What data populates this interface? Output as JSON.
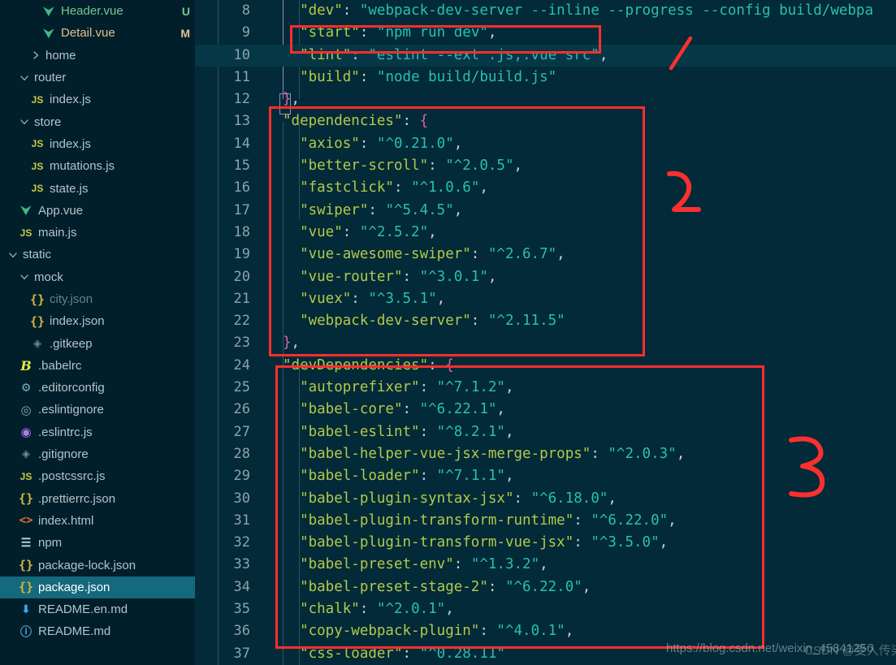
{
  "sidebar": {
    "items": [
      {
        "label": "Header.vue",
        "icon": "vue-icon",
        "indent": 3,
        "chevron": "none",
        "git": "U",
        "state": "untracked"
      },
      {
        "label": "Detail.vue",
        "icon": "vue-icon",
        "indent": 3,
        "chevron": "none",
        "git": "M",
        "state": "modified"
      },
      {
        "label": "home",
        "icon": "none",
        "indent": 2,
        "chevron": "right",
        "git": "",
        "state": "normal"
      },
      {
        "label": "router",
        "icon": "none",
        "indent": 1,
        "chevron": "down",
        "git": "",
        "state": "normal"
      },
      {
        "label": "index.js",
        "icon": "js-icon",
        "indent": 2,
        "chevron": "none",
        "git": "",
        "state": "normal"
      },
      {
        "label": "store",
        "icon": "none",
        "indent": 1,
        "chevron": "down",
        "git": "",
        "state": "normal"
      },
      {
        "label": "index.js",
        "icon": "js-icon",
        "indent": 2,
        "chevron": "none",
        "git": "",
        "state": "normal"
      },
      {
        "label": "mutations.js",
        "icon": "js-icon",
        "indent": 2,
        "chevron": "none",
        "git": "",
        "state": "normal"
      },
      {
        "label": "state.js",
        "icon": "js-icon",
        "indent": 2,
        "chevron": "none",
        "git": "",
        "state": "normal"
      },
      {
        "label": "App.vue",
        "icon": "vue-icon",
        "indent": 1,
        "chevron": "none",
        "git": "",
        "state": "normal"
      },
      {
        "label": "main.js",
        "icon": "js-icon",
        "indent": 1,
        "chevron": "none",
        "git": "",
        "state": "normal"
      },
      {
        "label": "static",
        "icon": "none",
        "indent": 0,
        "chevron": "down",
        "git": "",
        "state": "normal"
      },
      {
        "label": "mock",
        "icon": "none",
        "indent": 1,
        "chevron": "down",
        "git": "",
        "state": "normal"
      },
      {
        "label": "city.json",
        "icon": "json-icon",
        "indent": 2,
        "chevron": "none",
        "git": "",
        "state": "dim"
      },
      {
        "label": "index.json",
        "icon": "json-icon",
        "indent": 2,
        "chevron": "none",
        "git": "",
        "state": "normal"
      },
      {
        "label": ".gitkeep",
        "icon": "diamond-icon",
        "indent": 2,
        "chevron": "none",
        "git": "",
        "state": "normal"
      },
      {
        "label": ".babelrc",
        "icon": "babel-icon",
        "indent": 1,
        "chevron": "none",
        "git": "",
        "state": "normal"
      },
      {
        "label": ".editorconfig",
        "icon": "gear-icon",
        "indent": 1,
        "chevron": "none",
        "git": "",
        "state": "normal"
      },
      {
        "label": ".eslintignore",
        "icon": "eslint-ignore-icon",
        "indent": 1,
        "chevron": "none",
        "git": "",
        "state": "normal"
      },
      {
        "label": ".eslintrc.js",
        "icon": "eslint-icon",
        "indent": 1,
        "chevron": "none",
        "git": "",
        "state": "normal"
      },
      {
        "label": ".gitignore",
        "icon": "diamond-icon",
        "indent": 1,
        "chevron": "none",
        "git": "",
        "state": "normal"
      },
      {
        "label": ".postcssrc.js",
        "icon": "js-icon",
        "indent": 1,
        "chevron": "none",
        "git": "",
        "state": "normal"
      },
      {
        "label": ".prettierrc.json",
        "icon": "json-icon",
        "indent": 1,
        "chevron": "none",
        "git": "",
        "state": "normal"
      },
      {
        "label": "index.html",
        "icon": "html-icon",
        "indent": 1,
        "chevron": "none",
        "git": "",
        "state": "normal"
      },
      {
        "label": "npm",
        "icon": "list-icon",
        "indent": 1,
        "chevron": "none",
        "git": "",
        "state": "normal"
      },
      {
        "label": "package-lock.json",
        "icon": "json-icon",
        "indent": 1,
        "chevron": "none",
        "git": "",
        "state": "normal"
      },
      {
        "label": "package.json",
        "icon": "json-icon",
        "indent": 1,
        "chevron": "none",
        "git": "",
        "state": "selected"
      },
      {
        "label": "README.en.md",
        "icon": "download-icon",
        "indent": 1,
        "chevron": "none",
        "git": "",
        "state": "normal"
      },
      {
        "label": "README.md",
        "icon": "info-icon",
        "indent": 1,
        "chevron": "none",
        "git": "",
        "state": "normal"
      }
    ]
  },
  "editor": {
    "first_line_number": 8,
    "active_line_number": 10,
    "lines": [
      {
        "n": 8,
        "tokens": [
          {
            "t": "\"dev\"",
            "c": "k"
          },
          {
            "t": ": ",
            "c": "p"
          },
          {
            "t": "\"webpack-dev-server --inline --progress --config build/webpa",
            "c": "v"
          }
        ],
        "indent": 2
      },
      {
        "n": 9,
        "tokens": [
          {
            "t": "\"start\"",
            "c": "k"
          },
          {
            "t": ": ",
            "c": "p"
          },
          {
            "t": "\"npm run dev\"",
            "c": "v"
          },
          {
            "t": ",",
            "c": "p"
          }
        ],
        "indent": 2
      },
      {
        "n": 10,
        "tokens": [
          {
            "t": "\"lint\"",
            "c": "k"
          },
          {
            "t": ": ",
            "c": "p"
          },
          {
            "t": "\"eslint --ext .js,.vue src\"",
            "c": "v"
          },
          {
            "t": ",",
            "c": "p"
          }
        ],
        "indent": 2
      },
      {
        "n": 11,
        "tokens": [
          {
            "t": "\"build\"",
            "c": "k"
          },
          {
            "t": ": ",
            "c": "p"
          },
          {
            "t": "\"node build/build.js\"",
            "c": "v"
          }
        ],
        "indent": 2
      },
      {
        "n": 12,
        "tokens": [
          {
            "t": "}",
            "c": "br"
          },
          {
            "t": ",",
            "c": "p"
          }
        ],
        "indent": 1
      },
      {
        "n": 13,
        "tokens": [
          {
            "t": "\"dependencies\"",
            "c": "k"
          },
          {
            "t": ": ",
            "c": "p"
          },
          {
            "t": "{",
            "c": "br"
          }
        ],
        "indent": 1
      },
      {
        "n": 14,
        "tokens": [
          {
            "t": "\"axios\"",
            "c": "k"
          },
          {
            "t": ": ",
            "c": "p"
          },
          {
            "t": "\"^0.21.0\"",
            "c": "v"
          },
          {
            "t": ",",
            "c": "p"
          }
        ],
        "indent": 2
      },
      {
        "n": 15,
        "tokens": [
          {
            "t": "\"better-scroll\"",
            "c": "k"
          },
          {
            "t": ": ",
            "c": "p"
          },
          {
            "t": "\"^2.0.5\"",
            "c": "v"
          },
          {
            "t": ",",
            "c": "p"
          }
        ],
        "indent": 2
      },
      {
        "n": 16,
        "tokens": [
          {
            "t": "\"fastclick\"",
            "c": "k"
          },
          {
            "t": ": ",
            "c": "p"
          },
          {
            "t": "\"^1.0.6\"",
            "c": "v"
          },
          {
            "t": ",",
            "c": "p"
          }
        ],
        "indent": 2
      },
      {
        "n": 17,
        "tokens": [
          {
            "t": "\"swiper\"",
            "c": "k"
          },
          {
            "t": ": ",
            "c": "p"
          },
          {
            "t": "\"^5.4.5\"",
            "c": "v"
          },
          {
            "t": ",",
            "c": "p"
          }
        ],
        "indent": 2
      },
      {
        "n": 18,
        "tokens": [
          {
            "t": "\"vue\"",
            "c": "k"
          },
          {
            "t": ": ",
            "c": "p"
          },
          {
            "t": "\"^2.5.2\"",
            "c": "v"
          },
          {
            "t": ",",
            "c": "p"
          }
        ],
        "indent": 2
      },
      {
        "n": 19,
        "tokens": [
          {
            "t": "\"vue-awesome-swiper\"",
            "c": "k"
          },
          {
            "t": ": ",
            "c": "p"
          },
          {
            "t": "\"^2.6.7\"",
            "c": "v"
          },
          {
            "t": ",",
            "c": "p"
          }
        ],
        "indent": 2
      },
      {
        "n": 20,
        "tokens": [
          {
            "t": "\"vue-router\"",
            "c": "k"
          },
          {
            "t": ": ",
            "c": "p"
          },
          {
            "t": "\"^3.0.1\"",
            "c": "v"
          },
          {
            "t": ",",
            "c": "p"
          }
        ],
        "indent": 2
      },
      {
        "n": 21,
        "tokens": [
          {
            "t": "\"vuex\"",
            "c": "k"
          },
          {
            "t": ": ",
            "c": "p"
          },
          {
            "t": "\"^3.5.1\"",
            "c": "v"
          },
          {
            "t": ",",
            "c": "p"
          }
        ],
        "indent": 2
      },
      {
        "n": 22,
        "tokens": [
          {
            "t": "\"webpack-dev-server\"",
            "c": "k"
          },
          {
            "t": ": ",
            "c": "p"
          },
          {
            "t": "\"^2.11.5\"",
            "c": "v"
          }
        ],
        "indent": 2
      },
      {
        "n": 23,
        "tokens": [
          {
            "t": "}",
            "c": "br"
          },
          {
            "t": ",",
            "c": "p"
          }
        ],
        "indent": 1
      },
      {
        "n": 24,
        "tokens": [
          {
            "t": "\"devDependencies\"",
            "c": "k"
          },
          {
            "t": ": ",
            "c": "p"
          },
          {
            "t": "{",
            "c": "br"
          }
        ],
        "indent": 1
      },
      {
        "n": 25,
        "tokens": [
          {
            "t": "\"autoprefixer\"",
            "c": "k"
          },
          {
            "t": ": ",
            "c": "p"
          },
          {
            "t": "\"^7.1.2\"",
            "c": "v"
          },
          {
            "t": ",",
            "c": "p"
          }
        ],
        "indent": 2
      },
      {
        "n": 26,
        "tokens": [
          {
            "t": "\"babel-core\"",
            "c": "k"
          },
          {
            "t": ": ",
            "c": "p"
          },
          {
            "t": "\"^6.22.1\"",
            "c": "v"
          },
          {
            "t": ",",
            "c": "p"
          }
        ],
        "indent": 2
      },
      {
        "n": 27,
        "tokens": [
          {
            "t": "\"babel-eslint\"",
            "c": "k"
          },
          {
            "t": ": ",
            "c": "p"
          },
          {
            "t": "\"^8.2.1\"",
            "c": "v"
          },
          {
            "t": ",",
            "c": "p"
          }
        ],
        "indent": 2
      },
      {
        "n": 28,
        "tokens": [
          {
            "t": "\"babel-helper-vue-jsx-merge-props\"",
            "c": "k"
          },
          {
            "t": ": ",
            "c": "p"
          },
          {
            "t": "\"^2.0.3\"",
            "c": "v"
          },
          {
            "t": ",",
            "c": "p"
          }
        ],
        "indent": 2
      },
      {
        "n": 29,
        "tokens": [
          {
            "t": "\"babel-loader\"",
            "c": "k"
          },
          {
            "t": ": ",
            "c": "p"
          },
          {
            "t": "\"^7.1.1\"",
            "c": "v"
          },
          {
            "t": ",",
            "c": "p"
          }
        ],
        "indent": 2
      },
      {
        "n": 30,
        "tokens": [
          {
            "t": "\"babel-plugin-syntax-jsx\"",
            "c": "k"
          },
          {
            "t": ": ",
            "c": "p"
          },
          {
            "t": "\"^6.18.0\"",
            "c": "v"
          },
          {
            "t": ",",
            "c": "p"
          }
        ],
        "indent": 2
      },
      {
        "n": 31,
        "tokens": [
          {
            "t": "\"babel-plugin-transform-runtime\"",
            "c": "k"
          },
          {
            "t": ": ",
            "c": "p"
          },
          {
            "t": "\"^6.22.0\"",
            "c": "v"
          },
          {
            "t": ",",
            "c": "p"
          }
        ],
        "indent": 2
      },
      {
        "n": 32,
        "tokens": [
          {
            "t": "\"babel-plugin-transform-vue-jsx\"",
            "c": "k"
          },
          {
            "t": ": ",
            "c": "p"
          },
          {
            "t": "\"^3.5.0\"",
            "c": "v"
          },
          {
            "t": ",",
            "c": "p"
          }
        ],
        "indent": 2
      },
      {
        "n": 33,
        "tokens": [
          {
            "t": "\"babel-preset-env\"",
            "c": "k"
          },
          {
            "t": ": ",
            "c": "p"
          },
          {
            "t": "\"^1.3.2\"",
            "c": "v"
          },
          {
            "t": ",",
            "c": "p"
          }
        ],
        "indent": 2
      },
      {
        "n": 34,
        "tokens": [
          {
            "t": "\"babel-preset-stage-2\"",
            "c": "k"
          },
          {
            "t": ": ",
            "c": "p"
          },
          {
            "t": "\"^6.22.0\"",
            "c": "v"
          },
          {
            "t": ",",
            "c": "p"
          }
        ],
        "indent": 2
      },
      {
        "n": 35,
        "tokens": [
          {
            "t": "\"chalk\"",
            "c": "k"
          },
          {
            "t": ": ",
            "c": "p"
          },
          {
            "t": "\"^2.0.1\"",
            "c": "v"
          },
          {
            "t": ",",
            "c": "p"
          }
        ],
        "indent": 2
      },
      {
        "n": 36,
        "tokens": [
          {
            "t": "\"copy-webpack-plugin\"",
            "c": "k"
          },
          {
            "t": ": ",
            "c": "p"
          },
          {
            "t": "\"^4.0.1\"",
            "c": "v"
          },
          {
            "t": ",",
            "c": "p"
          }
        ],
        "indent": 2
      },
      {
        "n": 37,
        "tokens": [
          {
            "t": "\"css-loader\"",
            "c": "k"
          },
          {
            "t": ": ",
            "c": "p"
          },
          {
            "t": "\"^0.28.11\"",
            "c": "v"
          }
        ],
        "indent": 2
      }
    ]
  },
  "annotations": {
    "color": "#fc2f2f",
    "marks": [
      {
        "label": "1",
        "shape": "stroke"
      },
      {
        "label": "2",
        "shape": "digit"
      },
      {
        "label": "3",
        "shape": "digit"
      }
    ],
    "boxes": [
      {
        "name": "start-script-box",
        "target": "line 9 \"start\": \"npm run dev\""
      },
      {
        "name": "dependencies-box",
        "target": "lines 13-23 dependencies block"
      },
      {
        "name": "devdependencies-box",
        "target": "lines 24-36 devDependencies block"
      }
    ]
  },
  "watermark": {
    "url": "https://blog.csdn.net/weixin_45841256",
    "overlay": "CSDN @受人传染"
  }
}
